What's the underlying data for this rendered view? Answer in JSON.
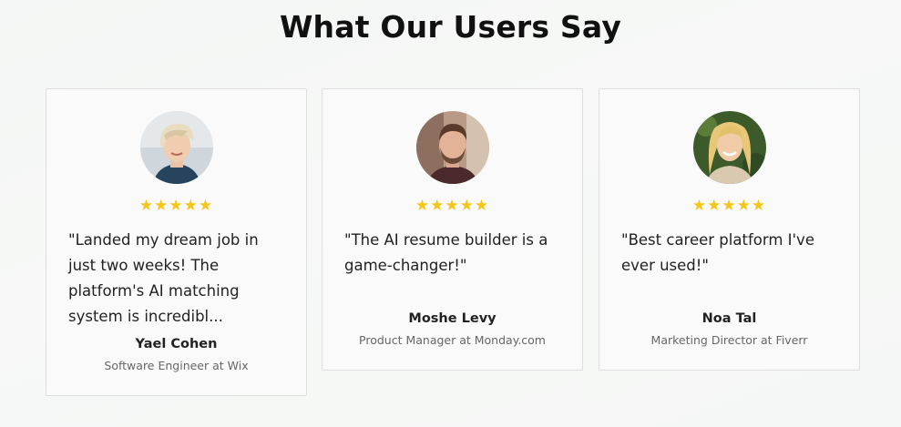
{
  "heading": "What Our Users Say",
  "testimonials": [
    {
      "avatar": "avatar-woman-short-blonde",
      "rating": 5,
      "quote": "\"Landed my dream job in just two weeks! The platform's AI matching system is incredibl...",
      "name": "Yael Cohen",
      "role": "Software Engineer at Wix"
    },
    {
      "avatar": "avatar-man-beard",
      "rating": 5,
      "quote": "\"The AI resume builder is a game-changer!\"",
      "name": "Moshe Levy",
      "role": "Product Manager at Monday.com"
    },
    {
      "avatar": "avatar-woman-long-blonde",
      "rating": 5,
      "quote": "\"Best career platform I've ever used!\"",
      "name": "Noa Tal",
      "role": "Marketing Director at Fiverr"
    }
  ],
  "colors": {
    "star": "#f5c518",
    "card_background": "#fafafa",
    "card_border": "#dedede"
  }
}
